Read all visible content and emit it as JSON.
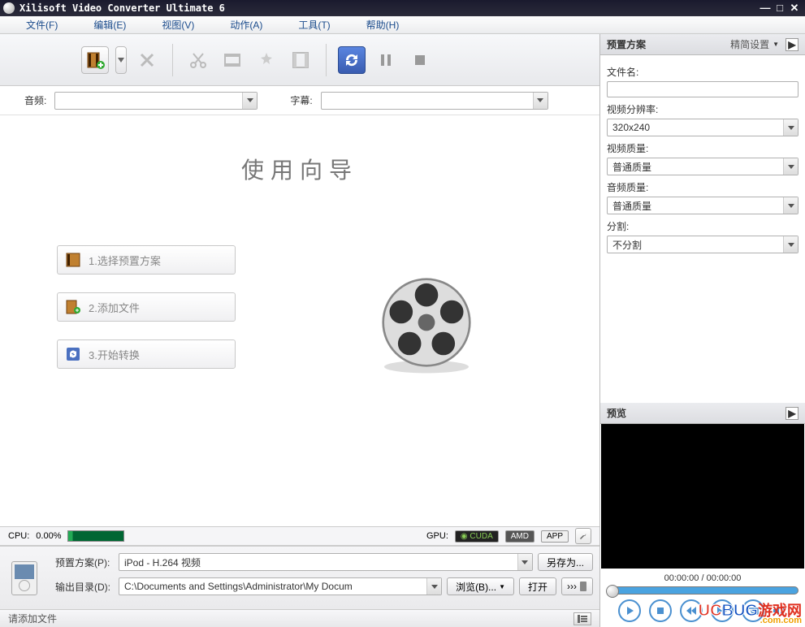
{
  "window": {
    "title": "Xilisoft Video Converter Ultimate 6"
  },
  "menu": {
    "file": "文件(F)",
    "edit": "编辑(E)",
    "view": "视图(V)",
    "action": "动作(A)",
    "tool": "工具(T)",
    "help": "帮助(H)"
  },
  "selects": {
    "audio_label": "音频:",
    "audio_value": "",
    "subtitle_label": "字幕:",
    "subtitle_value": ""
  },
  "wizard": {
    "title": "使用向导",
    "step1": "1.选择预置方案",
    "step2": "2.添加文件",
    "step3": "3.开始转换"
  },
  "cpu": {
    "label": "CPU:",
    "percent": "0.00%",
    "gpu_label": "GPU:",
    "cuda": "CUDA",
    "amd": "AMD",
    "app": "APP"
  },
  "bottom": {
    "preset_label": "预置方案(P):",
    "preset_value": "iPod - H.264 视频",
    "save_as": "另存为...",
    "output_label": "输出目录(D):",
    "output_value": "C:\\Documents and Settings\\Administrator\\My Docum",
    "browse": "浏览(B)...",
    "open": "打开"
  },
  "status": {
    "text": "请添加文件"
  },
  "right_panel": {
    "preset_title": "预置方案",
    "simple_settings": "精简设置",
    "filename_label": "文件名:",
    "filename_value": "",
    "resolution_label": "视频分辨率:",
    "resolution_value": "320x240",
    "vquality_label": "视频质量:",
    "vquality_value": "普通质量",
    "aquality_label": "音频质量:",
    "aquality_value": "普通质量",
    "split_label": "分割:",
    "split_value": "不分割",
    "preview_title": "预览",
    "time_current": "00:00:00",
    "time_total": "00:00:00"
  },
  "watermark": {
    "uc": "UC",
    "bug": "BUG",
    "yx": "游戏网",
    "com": ".com.com"
  }
}
